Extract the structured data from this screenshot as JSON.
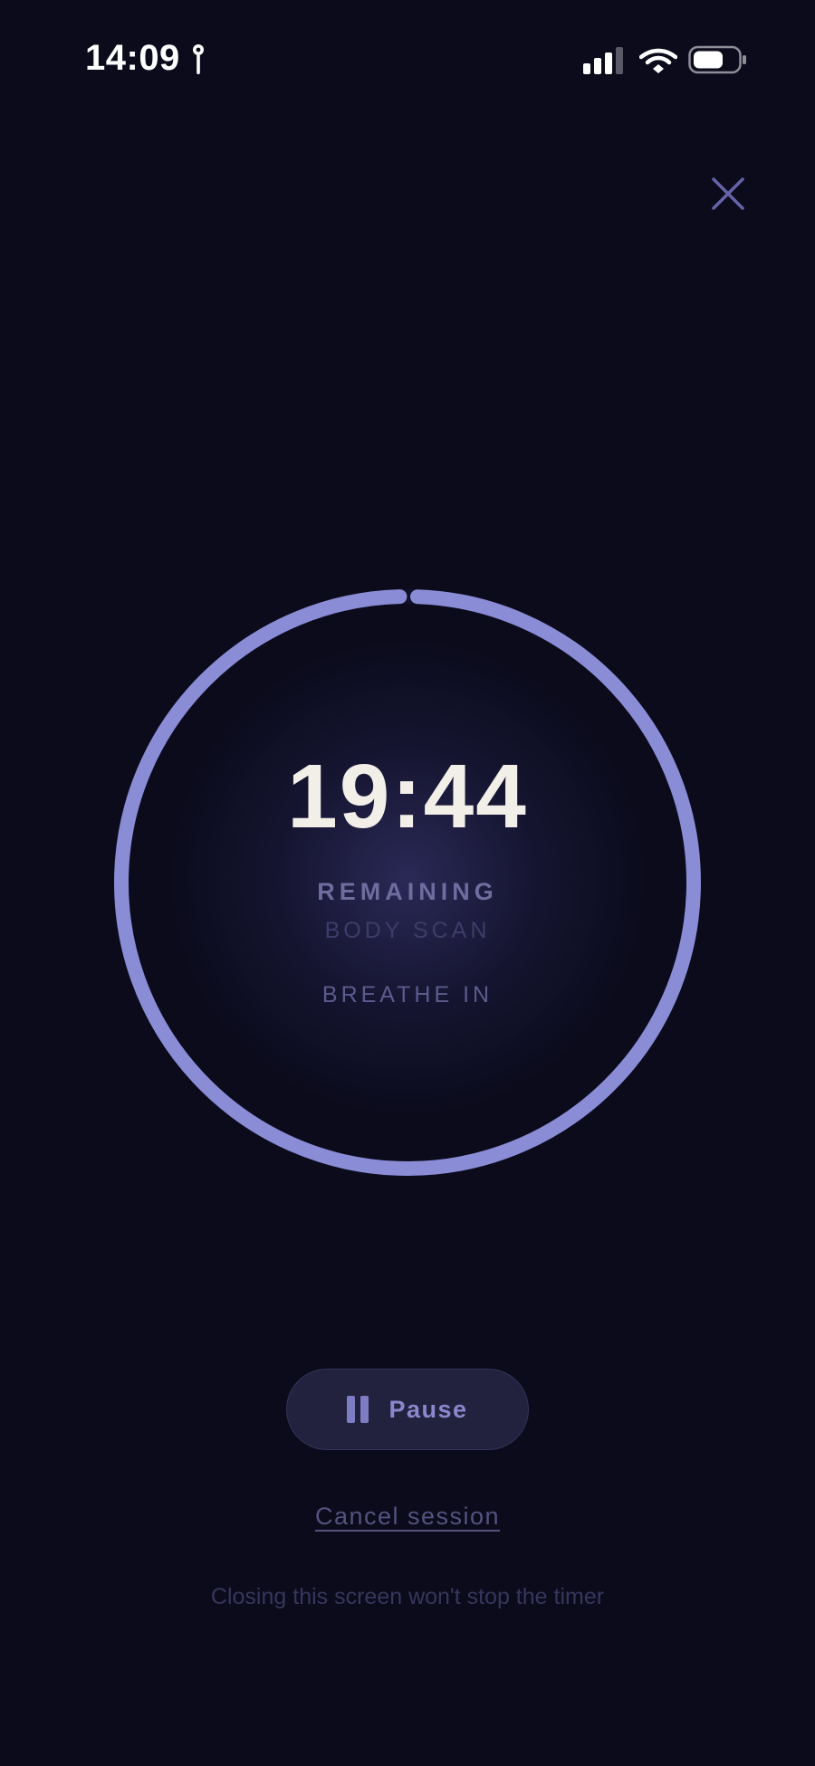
{
  "status_bar": {
    "time": "14:09",
    "icons": [
      "location-pin-icon",
      "cellular-signal-icon",
      "wifi-icon",
      "battery-icon"
    ]
  },
  "header": {
    "close_icon": "close-icon"
  },
  "timer": {
    "value": "19:44",
    "remaining_label": "REMAINING",
    "session_name": "BODY SCAN",
    "breath_cue": "BREATHE IN",
    "progress_fraction": 0.99
  },
  "controls": {
    "pause_label": "Pause",
    "pause_icon": "pause-icon",
    "cancel_label": "Cancel session"
  },
  "footer": {
    "note": "Closing this screen won't stop the timer"
  },
  "colors": {
    "background": "#0b0b1c",
    "ring": "#8a8cd6",
    "timer_text": "#f2efe8",
    "muted_text": "#6f6c9e",
    "button_bg": "#22213e"
  }
}
